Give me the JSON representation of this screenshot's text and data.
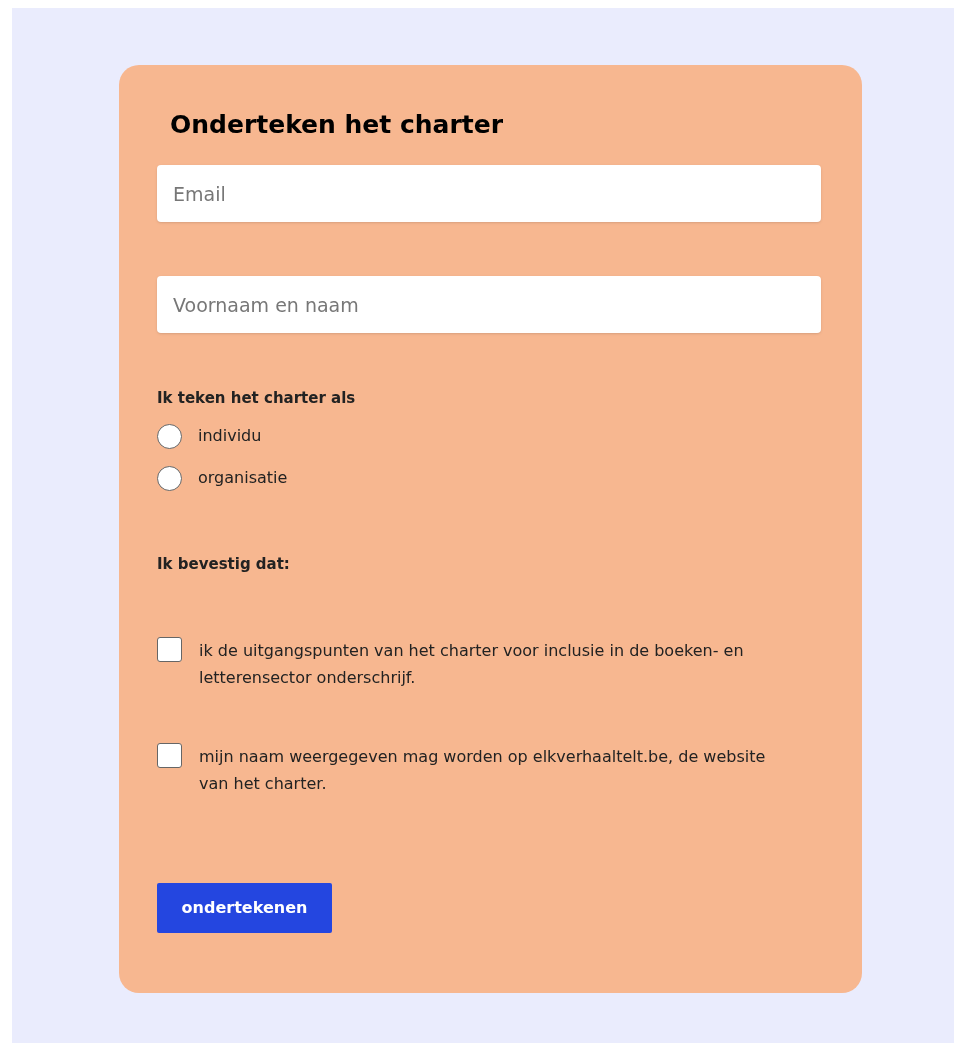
{
  "form": {
    "title": "Onderteken het charter",
    "fields": [
      {
        "placeholder": "Email"
      },
      {
        "placeholder": "Voornaam en naam"
      }
    ],
    "signer": {
      "label": "Ik teken het charter als",
      "options": [
        {
          "label": "individu",
          "selected": false
        },
        {
          "label": "organisatie",
          "selected": false
        }
      ]
    },
    "confirm": {
      "label": "Ik bevestig dat:",
      "items": [
        {
          "label": "ik de uitgangspunten van het charter voor inclusie in de boeken- en letterensector onderschrijf.",
          "checked": false
        },
        {
          "label": "mijn naam weergegeven mag worden op elkverhaaltelt.be, de website van het charter.",
          "checked": false
        }
      ]
    },
    "submit": "ondertekenen"
  }
}
